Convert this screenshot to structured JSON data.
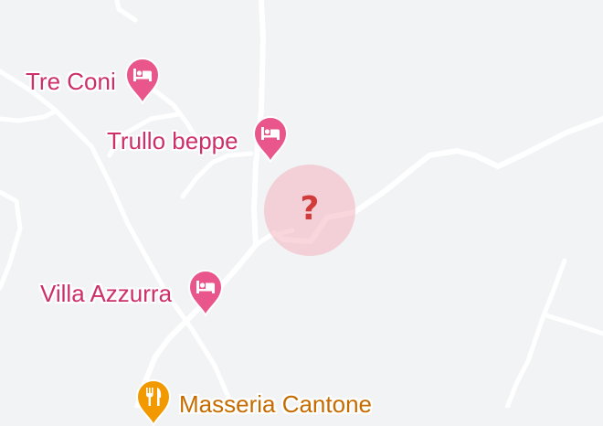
{
  "colors": {
    "background": "#f1f3f4",
    "road": "#ffffff",
    "hotel_pin": "#e8568c",
    "hotel_label": "#cc2f6a",
    "restaurant_pin": "#f29900",
    "restaurant_label": "#c56b00",
    "unknown_marker_fill": "#f4b2bf",
    "unknown_marker_glyph": "#d23b3b"
  },
  "places": [
    {
      "id": "tre-coni",
      "name": "Tre Coni",
      "category": "hotel",
      "icon": "bed-icon"
    },
    {
      "id": "trullo-beppe",
      "name": "Trullo beppe",
      "category": "hotel",
      "icon": "bed-icon"
    },
    {
      "id": "villa-azzurra",
      "name": "Villa Azzurra",
      "category": "hotel",
      "icon": "bed-icon"
    },
    {
      "id": "masseria-cantone",
      "name": "Masseria Cantone",
      "category": "restaurant",
      "icon": "fork-knife-icon"
    }
  ],
  "unknown_location": {
    "symbol": "?",
    "icon": "question-mark-icon"
  }
}
